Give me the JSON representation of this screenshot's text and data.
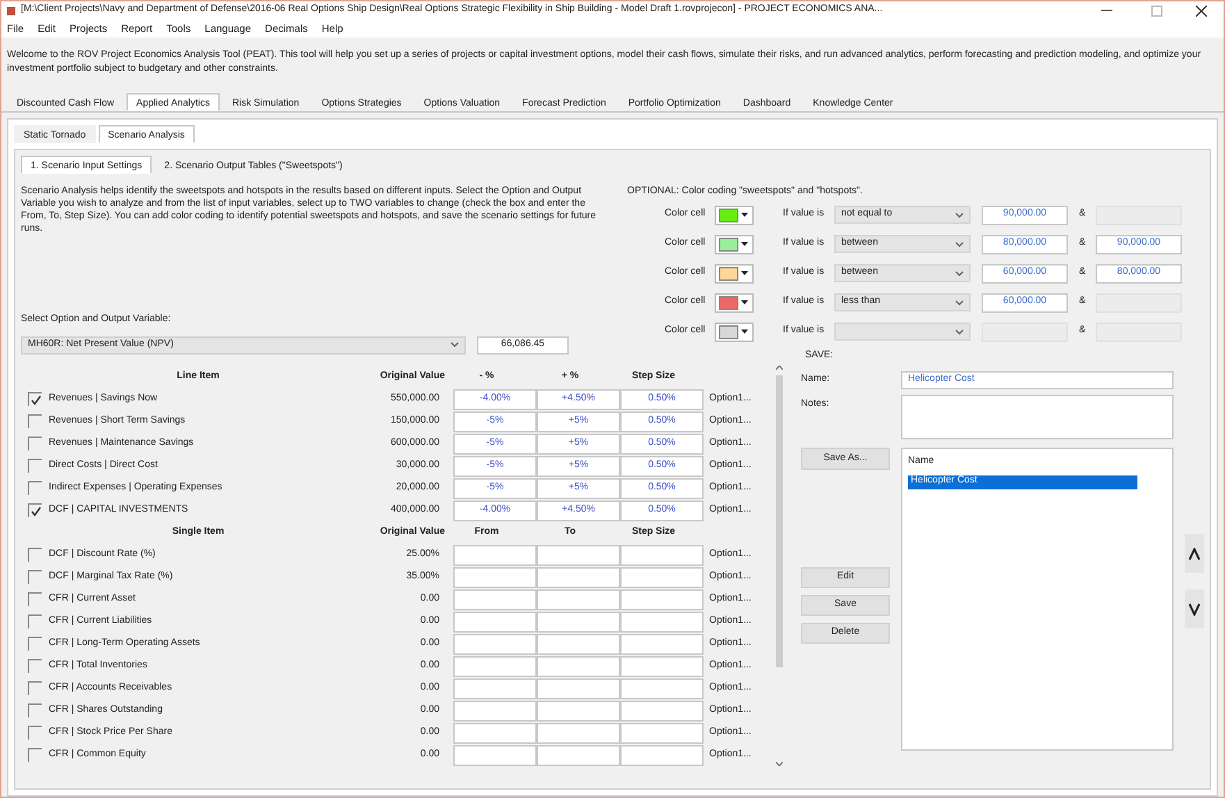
{
  "window": {
    "title": "[M:\\Client Projects\\Navy and Department of Defense\\2016-06 Real Options Ship Design\\Real Options Strategic Flexibility in Ship Building - Model Draft 1.rovprojecon] - PROJECT ECONOMICS ANA..."
  },
  "menu": [
    "File",
    "Edit",
    "Projects",
    "Report",
    "Tools",
    "Language",
    "Decimals",
    "Help"
  ],
  "welcome": "Welcome to the ROV Project Economics Analysis Tool (PEAT). This tool will help you set up a series of projects or capital investment options, model their cash flows, simulate their risks, and run advanced analytics, perform forecasting and prediction modeling, and optimize your investment portfolio subject to budgetary and other constraints.",
  "tabs": [
    {
      "label": "Discounted Cash Flow",
      "selected": false
    },
    {
      "label": "Applied Analytics",
      "selected": true
    },
    {
      "label": "Risk Simulation",
      "selected": false
    },
    {
      "label": "Options Strategies",
      "selected": false
    },
    {
      "label": "Options Valuation",
      "selected": false
    },
    {
      "label": "Forecast Prediction",
      "selected": false
    },
    {
      "label": "Portfolio Optimization",
      "selected": false
    },
    {
      "label": "Dashboard",
      "selected": false
    },
    {
      "label": "Knowledge Center",
      "selected": false
    }
  ],
  "subtabs": [
    {
      "label": "Static Tornado",
      "selected": false
    },
    {
      "label": "Scenario Analysis",
      "selected": true
    }
  ],
  "inner_tabs": [
    {
      "label": "1. Scenario Input Settings",
      "selected": true
    },
    {
      "label": "2. Scenario Output Tables (\"Sweetspots\")",
      "selected": false
    }
  ],
  "description": "Scenario Analysis helps identify the sweetspots and hotspots in the results based on different inputs. Select the Option and Output Variable you wish to analyze and from the list of input variables, select up to TWO variables to change (check the box and enter the From, To, Step Size). You can add color coding to identify potential sweetspots and hotspots, and save the scenario settings for future runs.",
  "select_label": "Select Option and Output Variable:",
  "output_variable": "MH60R: Net Present Value (NPV)",
  "output_value": "66,086.45",
  "color_coding": {
    "title": "OPTIONAL: Color coding \"sweetspots\" and \"hotspots\".",
    "rows": [
      {
        "label": "Color cell",
        "color": "#66ee11",
        "condition_label": "If value is",
        "condition": "not equal to",
        "value1": "90,000.00",
        "separator": "&"
      },
      {
        "label": "Color cell",
        "color": "#99ee99",
        "condition_label": "If value is",
        "condition": "between",
        "value1": "80,000.00",
        "separator": "&",
        "value2": "90,000.00"
      },
      {
        "label": "Color cell",
        "color": "#ffd699",
        "condition_label": "If value is",
        "condition": "between",
        "value1": "60,000.00",
        "separator": "&",
        "value2": "80,000.00"
      },
      {
        "label": "Color cell",
        "color": "#ee6666",
        "condition_label": "If value is",
        "condition": "less than",
        "value1": "60,000.00",
        "separator": "&"
      },
      {
        "label": "Color cell",
        "color": "#d8d8d8",
        "condition_label": "If value is",
        "separator": "&"
      }
    ]
  },
  "line_header": [
    "Line Item",
    "Original Value",
    "- %",
    "+ %",
    "Step Size"
  ],
  "line_items": [
    {
      "checked": true,
      "label": "Revenues | Savings Now",
      "original": "550,000.00",
      "minus": "-4.00%",
      "plus": "+4.50%",
      "step": "0.50%",
      "option": "Option1..."
    },
    {
      "checked": false,
      "label": "Revenues | Short Term Savings",
      "original": "150,000.00",
      "minus": "-5%",
      "plus": "+5%",
      "step": "0.50%",
      "option": "Option1..."
    },
    {
      "checked": false,
      "label": "Revenues | Maintenance Savings",
      "original": "600,000.00",
      "minus": "-5%",
      "plus": "+5%",
      "step": "0.50%",
      "option": "Option1..."
    },
    {
      "checked": false,
      "label": "Direct Costs | Direct Cost",
      "original": "30,000.00",
      "minus": "-5%",
      "plus": "+5%",
      "step": "0.50%",
      "option": "Option1..."
    },
    {
      "checked": false,
      "label": "Indirect Expenses | Operating Expenses",
      "original": "20,000.00",
      "minus": "-5%",
      "plus": "+5%",
      "step": "0.50%",
      "option": "Option1..."
    },
    {
      "checked": true,
      "label": "DCF | CAPITAL INVESTMENTS",
      "original": "400,000.00",
      "minus": "-4.00%",
      "plus": "+4.50%",
      "step": "0.50%",
      "option": "Option1..."
    }
  ],
  "single_header": [
    "Single Item",
    "Original Value",
    "From",
    "To",
    "Step Size"
  ],
  "single_items": [
    {
      "checked": false,
      "label": "DCF | Discount Rate (%)",
      "original": "25.00%",
      "option": "Option1..."
    },
    {
      "checked": false,
      "label": "DCF | Marginal Tax Rate (%)",
      "original": "35.00%",
      "option": "Option1..."
    },
    {
      "checked": false,
      "label": "CFR | Current Asset",
      "original": "0.00",
      "option": "Option1..."
    },
    {
      "checked": false,
      "label": "CFR | Current Liabilities",
      "original": "0.00",
      "option": "Option1..."
    },
    {
      "checked": false,
      "label": "CFR | Long-Term Operating Assets",
      "original": "0.00",
      "option": "Option1..."
    },
    {
      "checked": false,
      "label": "CFR | Total Inventories",
      "original": "0.00",
      "option": "Option1..."
    },
    {
      "checked": false,
      "label": "CFR | Accounts Receivables",
      "original": "0.00",
      "option": "Option1..."
    },
    {
      "checked": false,
      "label": "CFR | Shares Outstanding",
      "original": "0.00",
      "option": "Option1..."
    },
    {
      "checked": false,
      "label": "CFR | Stock Price Per Share",
      "original": "0.00",
      "option": "Option1..."
    },
    {
      "checked": false,
      "label": "CFR | Common Equity",
      "original": "0.00",
      "option": "Option1..."
    }
  ],
  "save": {
    "title": "SAVE:",
    "name_label": "Name:",
    "name_value": "Helicopter Cost",
    "notes_label": "Notes:",
    "list_header": "Name",
    "list_items": [
      {
        "label": "Helicopter Cost",
        "selected": true
      }
    ],
    "buttons": [
      "Save As...",
      "Edit",
      "Save",
      "Delete"
    ]
  }
}
